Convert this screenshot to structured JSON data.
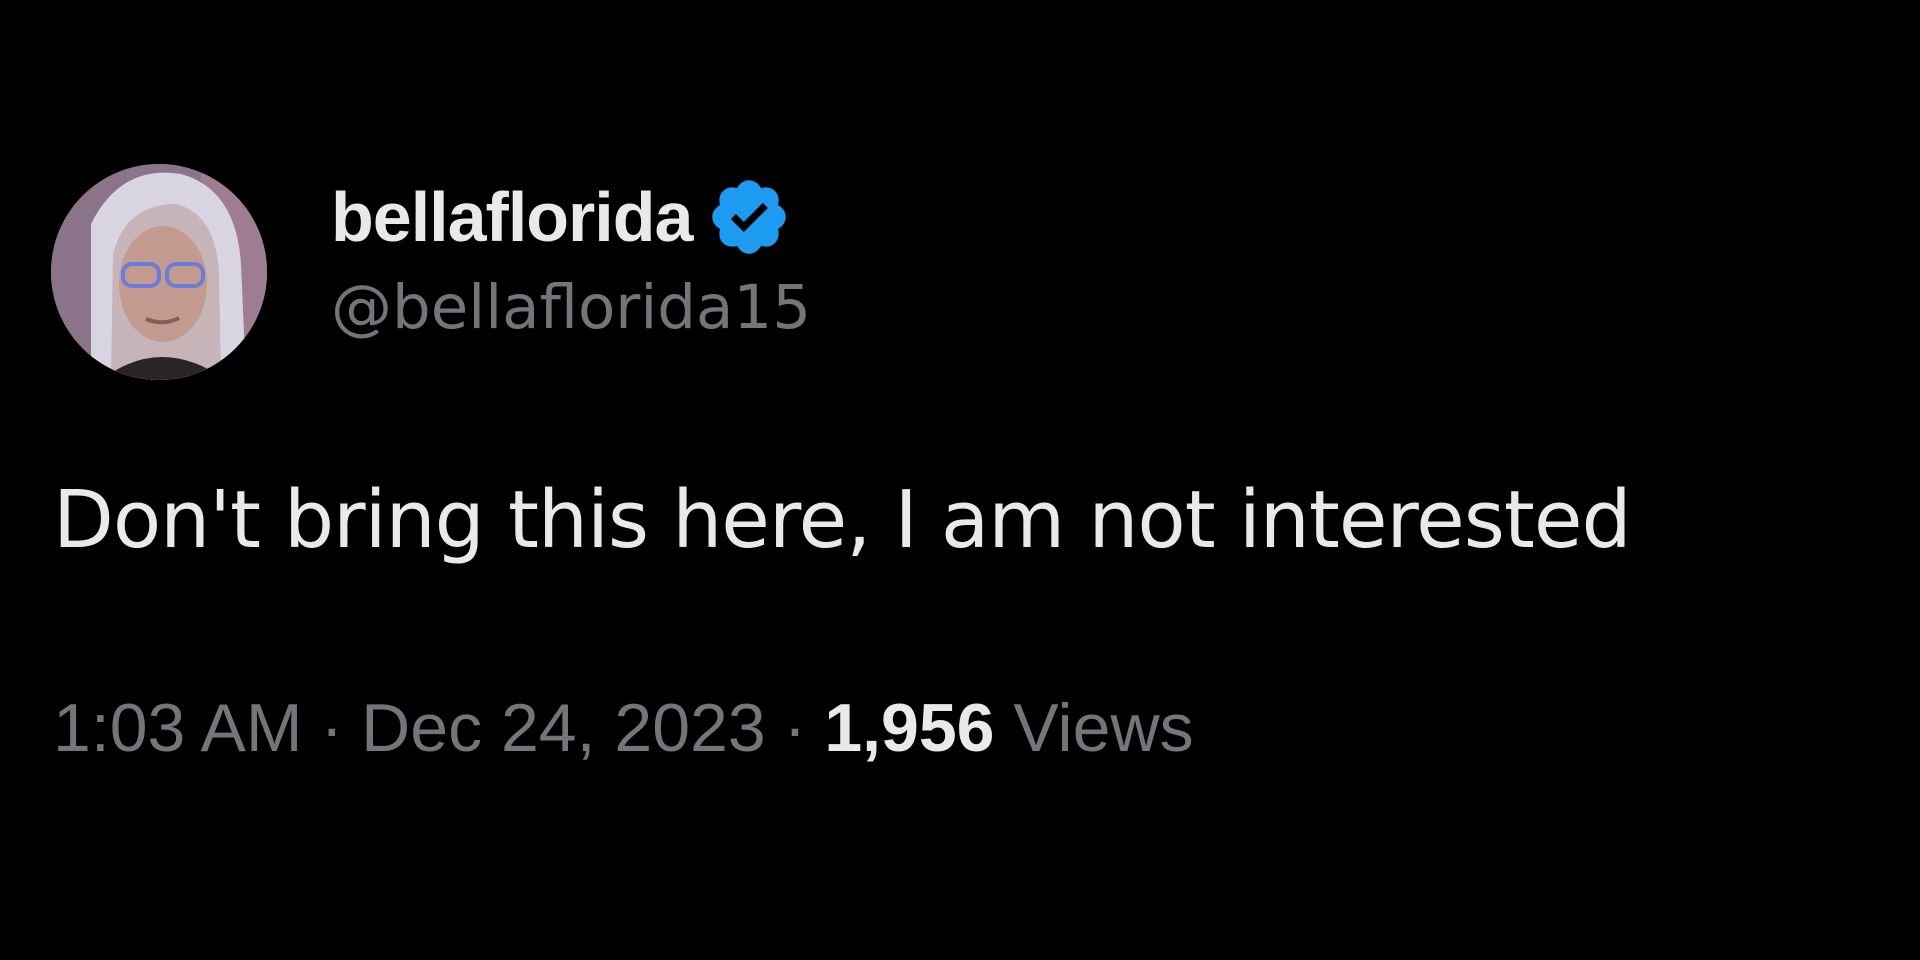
{
  "tweet": {
    "author": {
      "display_name": "bellaflorida",
      "handle": "@bellaflorida15",
      "verified": true,
      "verified_color": "#1d9bf0",
      "avatar_icon": "profile-avatar"
    },
    "text": "Don't bring this here, I am not interested",
    "meta": {
      "time": "1:03 AM",
      "separator": "·",
      "date": "Dec 24, 2023",
      "views_count": "1,956",
      "views_label": "Views"
    }
  }
}
